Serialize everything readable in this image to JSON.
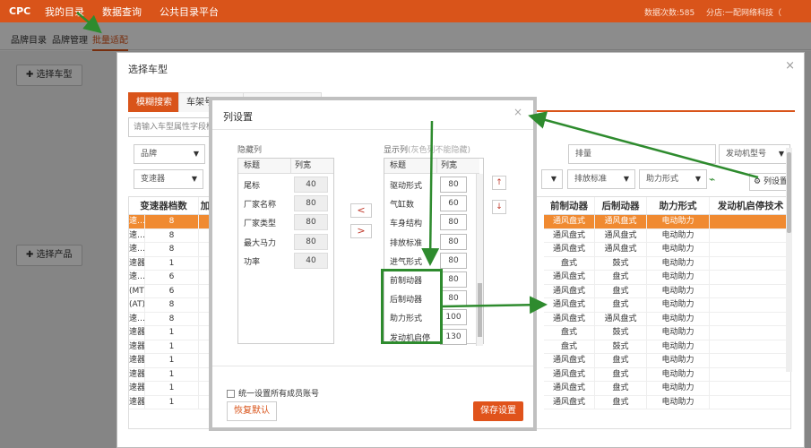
{
  "topbar": {
    "logo": "CPC",
    "nav": [
      "我的目录",
      "数据查询",
      "公共目录平台"
    ],
    "count_text": "数据次数:585",
    "company_text": "分店:一配网络科技（"
  },
  "subnav": [
    "品牌目录",
    "品牌管理",
    "批量适配"
  ],
  "background": {
    "select_vehicle_button": "选择车型",
    "select_product_button": "选择产品"
  },
  "vehicle_modal": {
    "title": "选择车型",
    "tabs": [
      "模糊搜索",
      "车架号找车型",
      "产品编号找车型"
    ],
    "search_placeholder": "请输入车型属性字段检",
    "filters_row1": [
      "品牌",
      "排量",
      "发动机型号"
    ],
    "filters_row2": [
      "变速器",
      "排放标准",
      "助力形式"
    ],
    "column_settings_button": "列设置",
    "grid_left": {
      "headers": [
        "变速器档数",
        "加"
      ],
      "rows": [
        [
          "速…",
          "8"
        ],
        [
          "速…",
          "8"
        ],
        [
          "速…",
          "8"
        ],
        [
          "速器",
          "1"
        ],
        [
          "速…",
          "6"
        ],
        [
          "(MT)",
          "6"
        ],
        [
          "(AT)",
          "8"
        ],
        [
          "速…",
          "8"
        ],
        [
          "速器",
          "1"
        ],
        [
          "速器",
          "1"
        ],
        [
          "速器",
          "1"
        ],
        [
          "速器",
          "1"
        ],
        [
          "速器",
          "1"
        ],
        [
          "速器",
          "1"
        ]
      ]
    },
    "grid_right": {
      "headers": [
        "前制动器",
        "后制动器",
        "助力形式",
        "发动机启停技术"
      ],
      "rows": [
        [
          "通风盘式",
          "通风盘式",
          "电动助力",
          ""
        ],
        [
          "通风盘式",
          "通风盘式",
          "电动助力",
          ""
        ],
        [
          "通风盘式",
          "通风盘式",
          "电动助力",
          ""
        ],
        [
          "盘式",
          "鼓式",
          "电动助力",
          ""
        ],
        [
          "通风盘式",
          "盘式",
          "电动助力",
          ""
        ],
        [
          "通风盘式",
          "盘式",
          "电动助力",
          ""
        ],
        [
          "通风盘式",
          "盘式",
          "电动助力",
          ""
        ],
        [
          "通风盘式",
          "通风盘式",
          "电动助力",
          ""
        ],
        [
          "盘式",
          "鼓式",
          "电动助力",
          ""
        ],
        [
          "盘式",
          "鼓式",
          "电动助力",
          ""
        ],
        [
          "通风盘式",
          "盘式",
          "电动助力",
          ""
        ],
        [
          "通风盘式",
          "盘式",
          "电动助力",
          ""
        ],
        [
          "通风盘式",
          "盘式",
          "电动助力",
          ""
        ],
        [
          "通风盘式",
          "盘式",
          "电动助力",
          ""
        ]
      ]
    }
  },
  "column_settings": {
    "title": "列设置",
    "hidden_label": "隐藏列",
    "visible_label": "显示列",
    "visible_note": "(灰色列不能隐藏)",
    "table_headers": [
      "标题",
      "列宽"
    ],
    "hidden_columns": [
      {
        "name": "尾标",
        "width": "40"
      },
      {
        "name": "厂家名称",
        "width": "80"
      },
      {
        "name": "厂家类型",
        "width": "80"
      },
      {
        "name": "最大马力",
        "width": "80"
      },
      {
        "name": "功率",
        "width": "40"
      }
    ],
    "visible_columns": [
      {
        "name": "驱动形式",
        "width": "80"
      },
      {
        "name": "气缸数",
        "width": "60"
      },
      {
        "name": "车身结构",
        "width": "80"
      },
      {
        "name": "排放标准",
        "width": "80"
      },
      {
        "name": "进气形式",
        "width": "80"
      },
      {
        "name": "前制动器",
        "width": "80"
      },
      {
        "name": "后制动器",
        "width": "80"
      },
      {
        "name": "助力形式",
        "width": "100"
      },
      {
        "name": "发动机启停",
        "width": "130"
      }
    ],
    "move_left": "<",
    "move_right": ">",
    "move_up": "↑",
    "move_down": "↓",
    "apply_all_label": "统一设置所有成员账号",
    "reset_button": "恢复默认",
    "save_button": "保存设置"
  },
  "colors": {
    "brand": "#d9541a",
    "selected_row": "#f08a31",
    "annotation": "#2e8b2e"
  }
}
